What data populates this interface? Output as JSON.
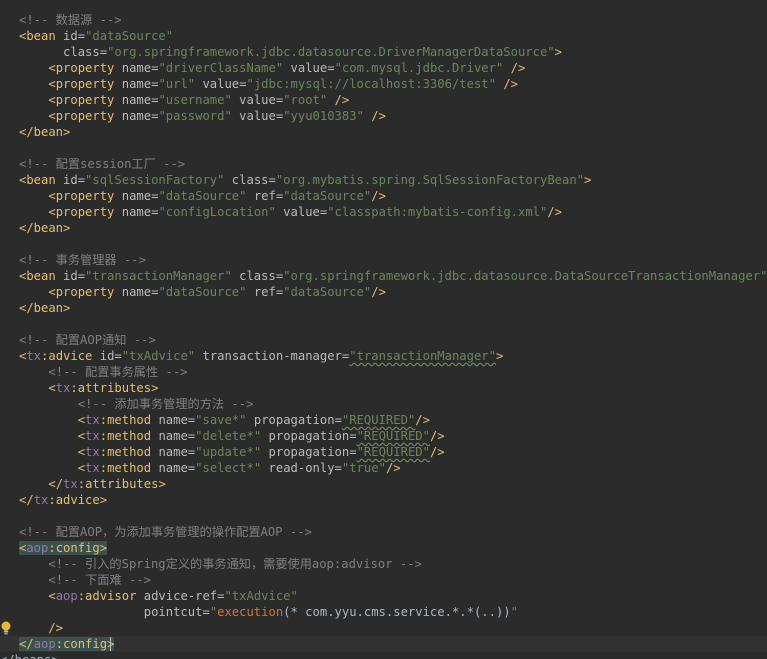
{
  "editor": {
    "lines": [
      [
        {
          "t": "<!-- 数据源 -->",
          "c": "comment"
        }
      ],
      [
        {
          "t": "<",
          "c": "tag"
        },
        {
          "t": "bean",
          "c": "tag"
        },
        {
          "t": " id=",
          "c": "attr"
        },
        {
          "t": "\"dataSource\"",
          "c": "val"
        }
      ],
      [
        {
          "t": "      class=",
          "c": "attr"
        },
        {
          "t": "\"org.springframework.jdbc.datasource.DriverManagerDataSource\"",
          "c": "val"
        },
        {
          "t": ">",
          "c": "tag"
        }
      ],
      [
        {
          "t": "    ",
          "c": "plain"
        },
        {
          "t": "<property",
          "c": "tag"
        },
        {
          "t": " name=",
          "c": "attr"
        },
        {
          "t": "\"driverClassName\"",
          "c": "val"
        },
        {
          "t": " value=",
          "c": "attr"
        },
        {
          "t": "\"com.mysql.jdbc.Driver\"",
          "c": "val"
        },
        {
          "t": " />",
          "c": "tag"
        }
      ],
      [
        {
          "t": "    ",
          "c": "plain"
        },
        {
          "t": "<property",
          "c": "tag"
        },
        {
          "t": " name=",
          "c": "attr"
        },
        {
          "t": "\"url\"",
          "c": "val"
        },
        {
          "t": " value=",
          "c": "attr"
        },
        {
          "t": "\"jdbc:mysql://localhost:3306/test\"",
          "c": "val"
        },
        {
          "t": " />",
          "c": "tag"
        }
      ],
      [
        {
          "t": "    ",
          "c": "plain"
        },
        {
          "t": "<property",
          "c": "tag"
        },
        {
          "t": " name=",
          "c": "attr"
        },
        {
          "t": "\"username\"",
          "c": "val"
        },
        {
          "t": " value=",
          "c": "attr"
        },
        {
          "t": "\"root\"",
          "c": "val"
        },
        {
          "t": " />",
          "c": "tag"
        }
      ],
      [
        {
          "t": "    ",
          "c": "plain"
        },
        {
          "t": "<property",
          "c": "tag"
        },
        {
          "t": " name=",
          "c": "attr"
        },
        {
          "t": "\"password\"",
          "c": "val"
        },
        {
          "t": " value=",
          "c": "attr"
        },
        {
          "t": "\"yyu010383\"",
          "c": "val"
        },
        {
          "t": " />",
          "c": "tag"
        }
      ],
      [
        {
          "t": "</bean>",
          "c": "tag"
        }
      ],
      [],
      [
        {
          "t": "<!-- 配置session工厂 -->",
          "c": "comment"
        }
      ],
      [
        {
          "t": "<bean",
          "c": "tag"
        },
        {
          "t": " id=",
          "c": "attr"
        },
        {
          "t": "\"sqlSessionFactory\"",
          "c": "val"
        },
        {
          "t": " class=",
          "c": "attr"
        },
        {
          "t": "\"org.mybatis.spring.SqlSessionFactoryBean\"",
          "c": "val"
        },
        {
          "t": ">",
          "c": "tag"
        }
      ],
      [
        {
          "t": "    ",
          "c": "plain"
        },
        {
          "t": "<property",
          "c": "tag"
        },
        {
          "t": " name=",
          "c": "attr"
        },
        {
          "t": "\"dataSource\"",
          "c": "val"
        },
        {
          "t": " ref=",
          "c": "attr"
        },
        {
          "t": "\"dataSource\"",
          "c": "val"
        },
        {
          "t": "/>",
          "c": "tag"
        }
      ],
      [
        {
          "t": "    ",
          "c": "plain"
        },
        {
          "t": "<property",
          "c": "tag"
        },
        {
          "t": " name=",
          "c": "attr"
        },
        {
          "t": "\"configLocation\"",
          "c": "val"
        },
        {
          "t": " value=",
          "c": "attr"
        },
        {
          "t": "\"classpath:mybatis-config.xml\"",
          "c": "val"
        },
        {
          "t": "/>",
          "c": "tag"
        }
      ],
      [
        {
          "t": "</bean>",
          "c": "tag"
        }
      ],
      [],
      [
        {
          "t": "<!-- 事务管理器 -->",
          "c": "comment"
        }
      ],
      [
        {
          "t": "<bean",
          "c": "tag"
        },
        {
          "t": " id=",
          "c": "attr"
        },
        {
          "t": "\"transactionManager\"",
          "c": "val"
        },
        {
          "t": " class=",
          "c": "attr"
        },
        {
          "t": "\"org.springframework.jdbc.datasource.DataSourceTransactionManager\"",
          "c": "val"
        },
        {
          "t": ">",
          "c": "tag"
        }
      ],
      [
        {
          "t": "    ",
          "c": "plain"
        },
        {
          "t": "<property",
          "c": "tag"
        },
        {
          "t": " name=",
          "c": "attr"
        },
        {
          "t": "\"dataSource\"",
          "c": "val"
        },
        {
          "t": " ref=",
          "c": "attr"
        },
        {
          "t": "\"dataSource\"",
          "c": "val"
        },
        {
          "t": "/>",
          "c": "tag"
        }
      ],
      [
        {
          "t": "</bean>",
          "c": "tag"
        }
      ],
      [],
      [
        {
          "t": "<!-- 配置AOP通知 -->",
          "c": "comment"
        }
      ],
      [
        {
          "t": "<",
          "c": "tag"
        },
        {
          "t": "tx",
          "c": "ns"
        },
        {
          "t": ":advice",
          "c": "tag"
        },
        {
          "t": " id=",
          "c": "attr"
        },
        {
          "t": "\"txAdvice\"",
          "c": "val"
        },
        {
          "t": " transaction-manager=",
          "c": "attr"
        },
        {
          "t": "\"transactionManager\"",
          "c": "val",
          "w": true
        },
        {
          "t": ">",
          "c": "tag"
        }
      ],
      [
        {
          "t": "    ",
          "c": "plain"
        },
        {
          "t": "<!-- 配置事务属性 -->",
          "c": "comment"
        }
      ],
      [
        {
          "t": "    ",
          "c": "plain"
        },
        {
          "t": "<",
          "c": "tag"
        },
        {
          "t": "tx",
          "c": "ns"
        },
        {
          "t": ":attributes>",
          "c": "tag"
        }
      ],
      [
        {
          "t": "        ",
          "c": "plain"
        },
        {
          "t": "<!-- 添加事务管理的方法 -->",
          "c": "comment"
        }
      ],
      [
        {
          "t": "        ",
          "c": "plain"
        },
        {
          "t": "<",
          "c": "tag"
        },
        {
          "t": "tx",
          "c": "ns"
        },
        {
          "t": ":method",
          "c": "tag"
        },
        {
          "t": " name=",
          "c": "attr"
        },
        {
          "t": "\"save*\"",
          "c": "val"
        },
        {
          "t": " propagation=",
          "c": "attr"
        },
        {
          "t": "\"REQUIRED\"",
          "c": "val",
          "w": true
        },
        {
          "t": "/>",
          "c": "tag"
        }
      ],
      [
        {
          "t": "        ",
          "c": "plain"
        },
        {
          "t": "<",
          "c": "tag"
        },
        {
          "t": "tx",
          "c": "ns"
        },
        {
          "t": ":method",
          "c": "tag"
        },
        {
          "t": " name=",
          "c": "attr"
        },
        {
          "t": "\"delete*\"",
          "c": "val"
        },
        {
          "t": " propagation=",
          "c": "attr"
        },
        {
          "t": "\"REQUIRED\"",
          "c": "val",
          "w": true
        },
        {
          "t": "/>",
          "c": "tag"
        }
      ],
      [
        {
          "t": "        ",
          "c": "plain"
        },
        {
          "t": "<",
          "c": "tag"
        },
        {
          "t": "tx",
          "c": "ns"
        },
        {
          "t": ":method",
          "c": "tag"
        },
        {
          "t": " name=",
          "c": "attr"
        },
        {
          "t": "\"update*\"",
          "c": "val"
        },
        {
          "t": " propagation=",
          "c": "attr"
        },
        {
          "t": "\"REQUIRED\"",
          "c": "val",
          "w": true
        },
        {
          "t": "/>",
          "c": "tag"
        }
      ],
      [
        {
          "t": "        ",
          "c": "plain"
        },
        {
          "t": "<",
          "c": "tag"
        },
        {
          "t": "tx",
          "c": "ns"
        },
        {
          "t": ":method",
          "c": "tag"
        },
        {
          "t": " name=",
          "c": "attr"
        },
        {
          "t": "\"select*\"",
          "c": "val"
        },
        {
          "t": " read-only=",
          "c": "attr"
        },
        {
          "t": "\"true\"",
          "c": "val"
        },
        {
          "t": "/>",
          "c": "tag"
        }
      ],
      [
        {
          "t": "    ",
          "c": "plain"
        },
        {
          "t": "</",
          "c": "tag"
        },
        {
          "t": "tx",
          "c": "ns"
        },
        {
          "t": ":attributes>",
          "c": "tag"
        }
      ],
      [
        {
          "t": "</",
          "c": "tag"
        },
        {
          "t": "tx",
          "c": "ns"
        },
        {
          "t": ":advice>",
          "c": "tag"
        }
      ],
      [],
      [
        {
          "t": "<!-- 配置AOP，为添加事务管理的操作配置AOP -->",
          "c": "comment"
        }
      ],
      [
        {
          "t": "<",
          "c": "tag",
          "m": true
        },
        {
          "t": "aop",
          "c": "ns",
          "m": true
        },
        {
          "t": ":config",
          "c": "tag",
          "m": true
        },
        {
          "t": ">",
          "c": "tag",
          "m": true
        }
      ],
      [
        {
          "t": "    ",
          "c": "plain"
        },
        {
          "t": "<!-- 引入的Spring定义的事务通知，需要使用aop:advisor -->",
          "c": "comment"
        }
      ],
      [
        {
          "t": "    ",
          "c": "plain"
        },
        {
          "t": "<!-- 下面难 -->",
          "c": "comment"
        }
      ],
      [
        {
          "t": "    ",
          "c": "plain"
        },
        {
          "t": "<",
          "c": "tag"
        },
        {
          "t": "aop",
          "c": "ns"
        },
        {
          "t": ":advisor",
          "c": "tag"
        },
        {
          "t": " advice-ref=",
          "c": "attr"
        },
        {
          "t": "\"txAdvice\"",
          "c": "val"
        }
      ],
      [
        {
          "t": "                 pointcut=",
          "c": "attr"
        },
        {
          "t": "\"",
          "c": "val"
        },
        {
          "t": "execution",
          "c": "fn"
        },
        {
          "t": "(* com.yyu.cms.service.*.*(..))",
          "c": "plain"
        },
        {
          "t": "\"",
          "c": "val"
        }
      ],
      [
        {
          "t": "    />",
          "c": "tag"
        }
      ],
      [
        {
          "t": "</",
          "c": "tag",
          "m": true
        },
        {
          "t": "aop",
          "c": "ns",
          "m": true
        },
        {
          "t": ":config",
          "c": "tag",
          "m": true
        },
        {
          "t": ">",
          "c": "tag",
          "m": true
        }
      ]
    ],
    "current_line": 39,
    "partial_last_line": "</beans>"
  },
  "colors": {
    "background": "#2b2b2b",
    "comment": "#808080",
    "tag": "#e8bf6a",
    "namespace": "#9876aa",
    "attribute": "#bababa",
    "string": "#6a8759",
    "brace_match": "#3b514d",
    "current_line": "#323232"
  },
  "icons": {
    "gutter": "lightbulb-icon"
  }
}
